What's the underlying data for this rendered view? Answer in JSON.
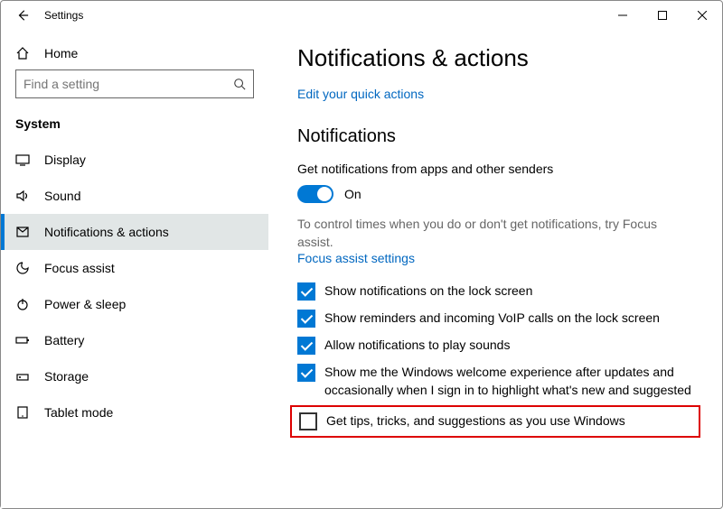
{
  "window": {
    "title": "Settings"
  },
  "sidebar": {
    "home": "Home",
    "searchPlaceholder": "Find a setting",
    "category": "System",
    "items": [
      {
        "label": "Display"
      },
      {
        "label": "Sound"
      },
      {
        "label": "Notifications & actions"
      },
      {
        "label": "Focus assist"
      },
      {
        "label": "Power & sleep"
      },
      {
        "label": "Battery"
      },
      {
        "label": "Storage"
      },
      {
        "label": "Tablet mode"
      }
    ]
  },
  "main": {
    "title": "Notifications & actions",
    "quickActionsLink": "Edit your quick actions",
    "sectionTitle": "Notifications",
    "notificationsLabel": "Get notifications from apps and other senders",
    "toggleState": "On",
    "focusAssistText": "To control times when you do or don't get notifications, try Focus assist.",
    "focusAssistLink": "Focus assist settings",
    "checks": [
      {
        "label": "Show notifications on the lock screen",
        "checked": true
      },
      {
        "label": "Show reminders and incoming VoIP calls on the lock screen",
        "checked": true
      },
      {
        "label": "Allow notifications to play sounds",
        "checked": true
      },
      {
        "label": "Show me the Windows welcome experience after updates and occasionally when I sign in to highlight what's new and suggested",
        "checked": true
      },
      {
        "label": "Get tips, tricks, and suggestions as you use Windows",
        "checked": false,
        "highlight": true
      }
    ]
  }
}
